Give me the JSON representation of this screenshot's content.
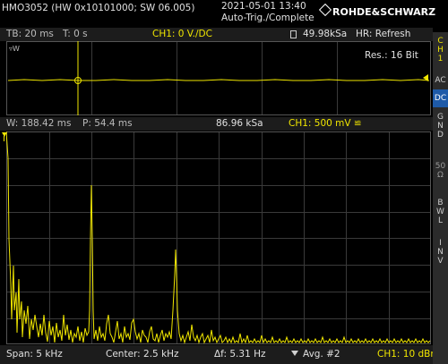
{
  "header": {
    "instrument": "HMO3052 (HW 0x10101000; SW 06.005)",
    "datetime": "2021-05-01 13:40",
    "trigger_status": "Auto-Trig./Complete",
    "brand": "ROHDE&SCHWARZ"
  },
  "timebase_bar": {
    "tb": "TB: 20 ms",
    "t": "T: 0 s",
    "ch_setting": "CH1: 0 V./DC",
    "sample_rate": "49.98kSa",
    "acq_mode": "HR: Refresh"
  },
  "time_view": {
    "resolution": "Res.: 16 Bit",
    "marker": "▿W"
  },
  "fft_bar": {
    "window": "W: 188.42 ms",
    "position": "P: 54.4 ms",
    "sample_rate": "86.96 kSa",
    "ch_scale": "CH1: 500 mV ≌"
  },
  "footer": {
    "span": "Span: 5 kHz",
    "center": "Center: 2.5 kHz",
    "delta_f": "Δf: 5.31 Hz",
    "avg": "Avg. #2",
    "ch_level": "CH1: 10 dBm"
  },
  "sidebar": {
    "channel_label_1": "C",
    "channel_label_2": "H",
    "channel_label_3": "1",
    "ac": "AC",
    "dc": "DC",
    "gnd_1": "G",
    "gnd_2": "N",
    "gnd_3": "D",
    "ohm_1": "50",
    "ohm_2": "Ω",
    "bwl_1": "B",
    "bwl_2": "W",
    "bwl_3": "L",
    "inv_1": "I",
    "inv_2": "N",
    "inv_3": "V"
  },
  "colors": {
    "trace": "#f0e600",
    "grid": "#3a3a3a",
    "active_button": "#1e5aa8",
    "background": "#000000"
  }
}
